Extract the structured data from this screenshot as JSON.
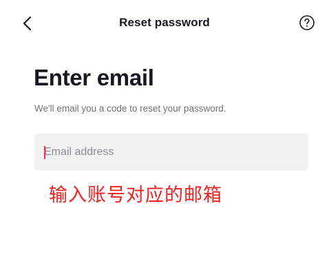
{
  "header": {
    "title": "Reset password",
    "back_icon": "chevron-left-icon",
    "help_icon": "question-circle-icon"
  },
  "main": {
    "heading": "Enter email",
    "subtitle": "We'll email you a code to reset your password.",
    "email_input": {
      "value": "",
      "placeholder": "Email address"
    },
    "annotation": "输入账号对应的邮箱"
  },
  "colors": {
    "text_primary": "#161823",
    "text_secondary": "#6f7178",
    "input_background": "#f1f1f2",
    "caret": "#fe2c55",
    "annotation": "#ff1d1d"
  }
}
